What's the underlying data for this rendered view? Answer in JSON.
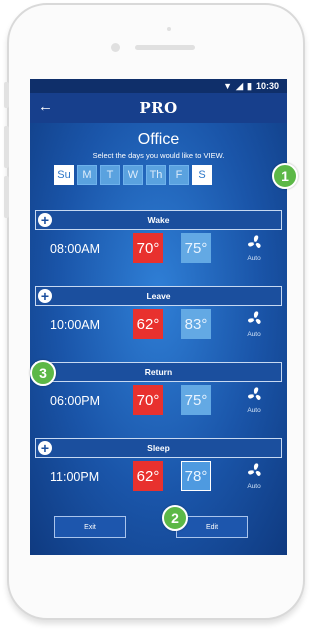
{
  "status": {
    "time": "10:30"
  },
  "app": {
    "logo": "PRO",
    "back_icon": "back-arrow-icon"
  },
  "screen": {
    "title": "Office",
    "subtitle": "Select the days you would like to VIEW."
  },
  "days": [
    {
      "label": "Su",
      "selected": true
    },
    {
      "label": "M",
      "selected": false
    },
    {
      "label": "T",
      "selected": false
    },
    {
      "label": "W",
      "selected": false
    },
    {
      "label": "Th",
      "selected": false
    },
    {
      "label": "F",
      "selected": false
    },
    {
      "label": "S",
      "selected": true
    }
  ],
  "periods": [
    {
      "name": "Wake",
      "time": "08:00AM",
      "heat": "70°",
      "cool": "75°",
      "fan": "Auto"
    },
    {
      "name": "Leave",
      "time": "10:00AM",
      "heat": "62°",
      "cool": "83°",
      "fan": "Auto"
    },
    {
      "name": "Return",
      "time": "06:00PM",
      "heat": "70°",
      "cool": "75°",
      "fan": "Auto"
    },
    {
      "name": "Sleep",
      "time": "11:00PM",
      "heat": "62°",
      "cool": "78°",
      "fan": "Auto"
    }
  ],
  "buttons": {
    "exit": "Exit",
    "edit": "Edit"
  },
  "callouts": {
    "one": "1",
    "two": "2",
    "three": "3"
  },
  "colors": {
    "heat": "#e8312e",
    "cool": "#63a9e4",
    "callout": "#5cb847",
    "header": "#173f8c"
  }
}
